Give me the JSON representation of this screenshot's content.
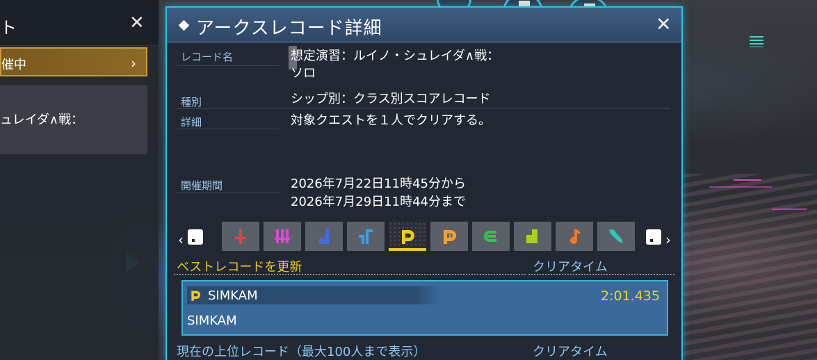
{
  "left_panel": {
    "title_fragment": "ト",
    "close_label": "✕",
    "tab_label": "催中",
    "tab_chevron": "›",
    "box_text": "ュレイダ∧戦："
  },
  "dialog": {
    "title": "アークスレコード詳細",
    "close_label": "✕",
    "fields": {
      "record_name_label": "レコード名",
      "record_name_line1": "想定演習：ルイノ・シュレイダ∧戦：",
      "record_name_line2": "ソロ",
      "type_label": "種別",
      "type_value": "シップ別：クラス別スコアレコード",
      "detail_label": "詳細",
      "detail_value": "対象クエストを１人でクリアする。",
      "period_label": "開催期間",
      "period_start": "2026年7月22日11時45分から",
      "period_end": "2026年7月29日11時44分まで"
    },
    "class_tabs": {
      "prev_arrow": "‹",
      "next_arrow": "›",
      "items": [
        {
          "name": "hunter",
          "color": "#e8423a"
        },
        {
          "name": "fighter",
          "color": "#d94ad0"
        },
        {
          "name": "ranger",
          "color": "#3d6de0"
        },
        {
          "name": "gunner",
          "color": "#3d9fe8"
        },
        {
          "name": "force",
          "color": "#f1cb14",
          "selected": true
        },
        {
          "name": "techter",
          "color": "#f0a030"
        },
        {
          "name": "braver",
          "color": "#2ec75a"
        },
        {
          "name": "bouncer",
          "color": "#a8d21a"
        },
        {
          "name": "waker",
          "color": "#f07a2a"
        },
        {
          "name": "slayer",
          "color": "#2ec9b5"
        }
      ]
    },
    "best_record": {
      "heading": "ベストレコードを更新",
      "time_heading": "クリアタイム",
      "player_name": "SIMKAM",
      "time": "2:01.435",
      "character_name": "SIMKAM"
    },
    "ranking": {
      "heading": "現在の上位レコード（最大100人まで表示）",
      "time_heading": "クリアタイム"
    }
  },
  "colors": {
    "accent_cyan": "#27c3e3",
    "label_blue": "#9fc6ea",
    "highlight_yellow": "#f1cb14",
    "record_bg": "#3a6a9a"
  }
}
